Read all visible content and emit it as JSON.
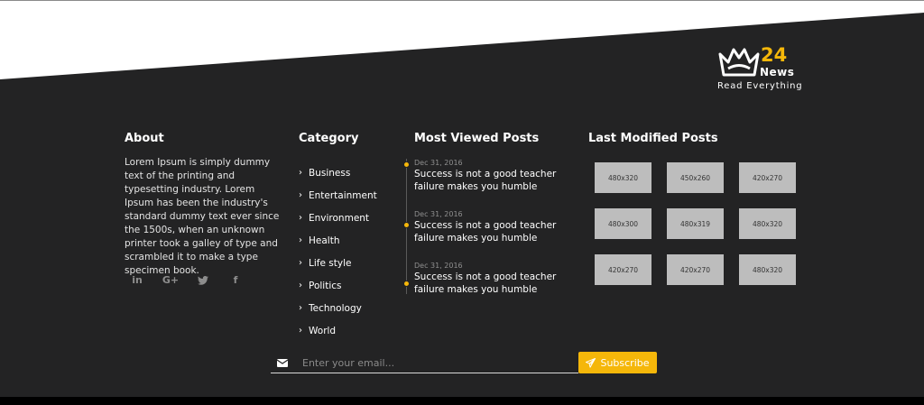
{
  "brand": {
    "number": "24",
    "name": "News",
    "tagline": "Read Everything",
    "accent_color": "#f5b70a",
    "background_color": "#232324"
  },
  "about": {
    "title": "About",
    "text": "Lorem Ipsum is simply dummy text of the printing and typesetting industry. Lorem Ipsum has been the industry's standard dummy text ever since the 1500s, when an unknown printer took a galley of type and scrambled it to make a type specimen book.",
    "social": [
      {
        "icon": "linkedin-icon",
        "glyph": "in"
      },
      {
        "icon": "google-plus-icon",
        "glyph": "G+"
      },
      {
        "icon": "twitter-icon",
        "glyph": "bird"
      },
      {
        "icon": "facebook-icon",
        "glyph": "f"
      }
    ]
  },
  "category": {
    "title": "Category",
    "items": [
      "Business",
      "Entertainment",
      "Environment",
      "Health",
      "Life style",
      "Politics",
      "Technology",
      "World"
    ]
  },
  "most_viewed": {
    "title": "Most Viewed Posts",
    "posts": [
      {
        "date": "Dec 31, 2016",
        "title": "Success is not a good teacher failure makes you humble"
      },
      {
        "date": "Dec 31, 2016",
        "title": "Success is not a good teacher failure makes you humble"
      },
      {
        "date": "Dec 31, 2016",
        "title": "Success is not a good teacher failure makes you humble"
      }
    ]
  },
  "last_modified": {
    "title": "Last Modified Posts",
    "thumbs": [
      "480x320",
      "450x260",
      "420x270",
      "480x300",
      "480x319",
      "480x320",
      "420x270",
      "420x270",
      "480x320"
    ]
  },
  "newsletter": {
    "placeholder": "Enter your email...",
    "icon": "envelope-icon",
    "button_label": "Subscribe",
    "button_icon": "paper-plane-icon"
  }
}
